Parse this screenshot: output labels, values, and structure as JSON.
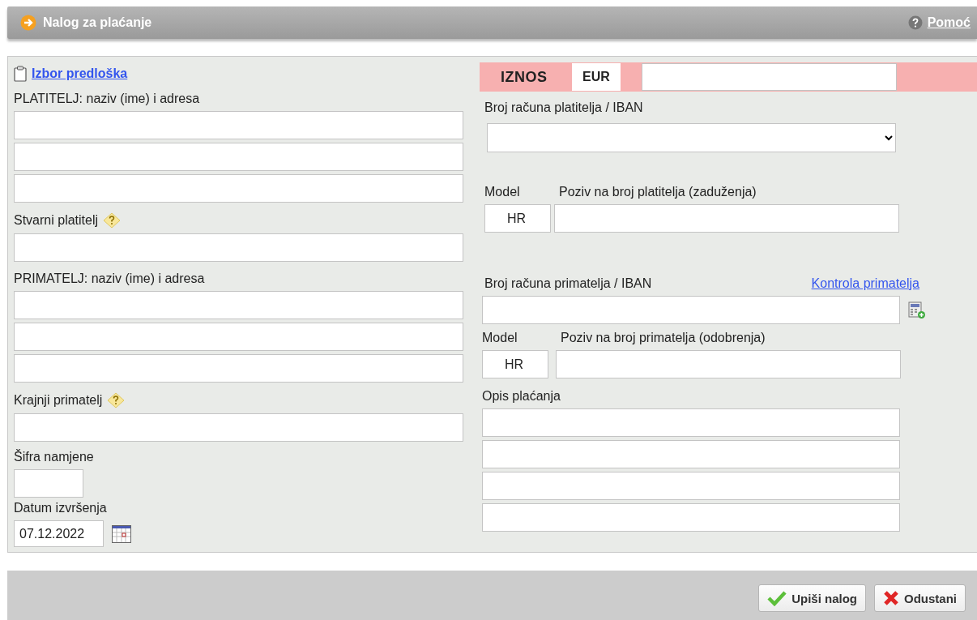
{
  "header": {
    "title": "Nalog za plaćanje",
    "help": "Pomoć"
  },
  "template_link": "Izbor predloška",
  "amount": {
    "label": "IZNOS",
    "currency": "EUR"
  },
  "left": [
    {
      "kind": "group",
      "label": "PLATITELJ: naziv (ime) i adresa",
      "fields": [
        {
          "kind": "text"
        },
        {
          "kind": "text"
        },
        {
          "kind": "text"
        }
      ]
    },
    {
      "kind": "group",
      "label": "Stvarni platitelj",
      "hint": true,
      "fields": [
        {
          "kind": "text"
        }
      ]
    },
    {
      "kind": "group",
      "label": "PRIMATELJ: naziv (ime) i adresa",
      "fields": [
        {
          "kind": "text"
        },
        {
          "kind": "text"
        },
        {
          "kind": "text"
        }
      ]
    },
    {
      "kind": "group",
      "label": "Krajnji primatelj",
      "hint": true,
      "fields": [
        {
          "kind": "text"
        }
      ]
    },
    {
      "kind": "short",
      "label": "Šifra namjene"
    },
    {
      "kind": "date",
      "label": "Datum izvršenja",
      "value": "07.12.2022"
    }
  ],
  "payer_account": {
    "label": "Broj računa platitelja / IBAN"
  },
  "payer_reference": {
    "model_label": "Model",
    "model": "HR",
    "label": "Poziv na broj platitelja (zaduženja)"
  },
  "payee_account": {
    "label": "Broj računa primatelja / IBAN",
    "link": "Kontrola primatelja"
  },
  "payee_reference": {
    "model_label": "Model",
    "model": "HR",
    "label": "Poziv na broj primatelja (odobrenja)"
  },
  "description": {
    "label": "Opis plaćanja",
    "fields": [
      {
        "kind": "text"
      },
      {
        "kind": "text"
      },
      {
        "kind": "text"
      },
      {
        "kind": "text"
      }
    ]
  },
  "buttons": [
    {
      "kind": "confirm",
      "label": "Upiši nalog"
    },
    {
      "kind": "cancel",
      "label": "Odustani"
    }
  ]
}
